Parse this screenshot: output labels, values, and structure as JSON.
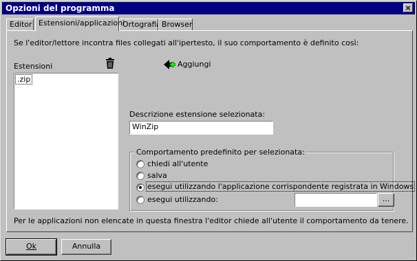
{
  "window": {
    "title": "Opzioni del programma",
    "close_glyph": "×"
  },
  "tabs": [
    {
      "label": "Editor"
    },
    {
      "label": "Estensioni/applicazioni",
      "active": true
    },
    {
      "label": "Ortografia"
    },
    {
      "label": "Browser"
    }
  ],
  "intro_text": "Se l'editor/lettore incontra files collegati all'ipertesto, il suo comportamento è definito così:",
  "extensions": {
    "label": "Estensioni",
    "items": [
      ".zip"
    ],
    "delete_icon": "trash-icon"
  },
  "add": {
    "label": "Aggiungi",
    "icon": "add-arrow-icon"
  },
  "description": {
    "label": "Descrizione estensione selezionata:",
    "value": "WinZip"
  },
  "behavior": {
    "legend": "Comportamento predefinito per selezionata:",
    "options": [
      {
        "label": "chiedi all'utente",
        "selected": false
      },
      {
        "label": "salva",
        "selected": false
      },
      {
        "label": "esegui utilizzando l'applicazione corrispondente registrata in Windows",
        "selected": true
      },
      {
        "label": "esegui utilizzando:",
        "selected": false
      }
    ],
    "app_path_value": "",
    "browse_label": "..."
  },
  "footer_note": "Per le applicazioni non elencate in questa finestra l'editor chiede all'utente il comportamento da tenere.",
  "buttons": {
    "ok_label": "Ok",
    "cancel_label": "Annulla"
  }
}
